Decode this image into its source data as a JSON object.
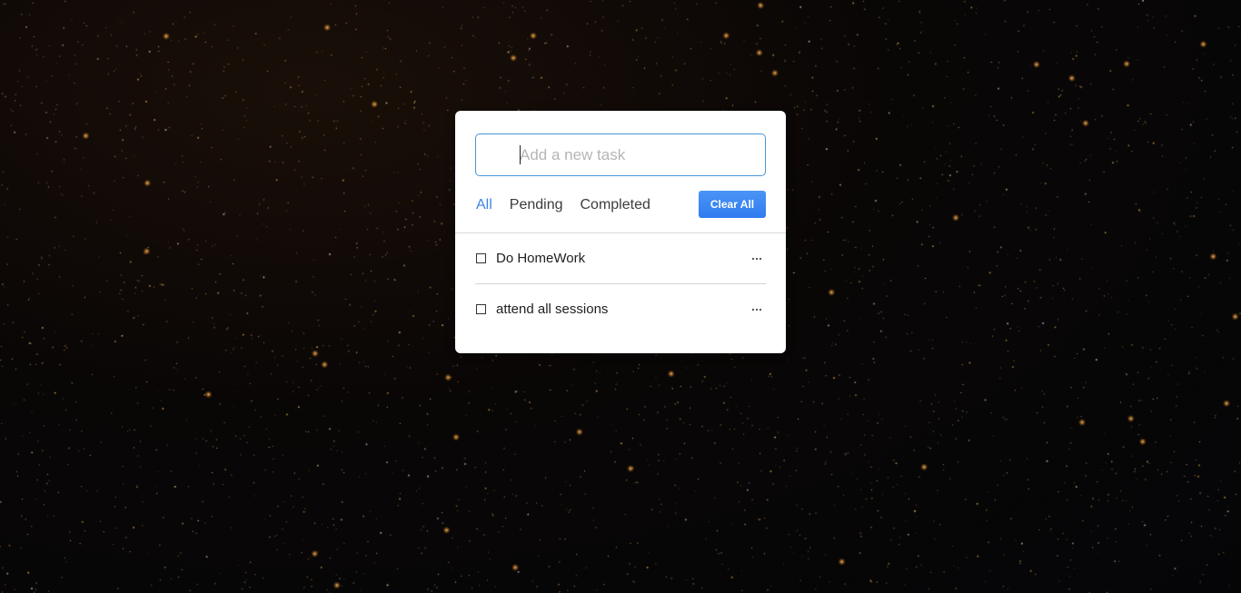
{
  "input": {
    "placeholder": "Add a new task",
    "value": ""
  },
  "filters": [
    {
      "label": "All",
      "active": true
    },
    {
      "label": "Pending",
      "active": false
    },
    {
      "label": "Completed",
      "active": false
    }
  ],
  "clear_all_label": "Clear All",
  "tasks": [
    {
      "label": "Do HomeWork",
      "checked": false,
      "menu_icon": "more-horizontal-icon"
    },
    {
      "label": "attend all sessions",
      "checked": false,
      "menu_icon": "more-horizontal-icon"
    }
  ],
  "colors": {
    "accent": "#3d84e6",
    "button": "#2f7cf0",
    "input_border": "#4b94d6",
    "card": "#ffffff",
    "background": "#050507"
  }
}
